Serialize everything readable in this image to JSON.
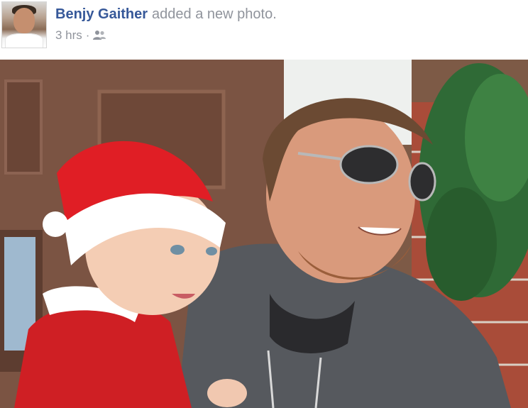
{
  "post": {
    "author": "Benjy Gaither",
    "action": "added a new photo.",
    "timestamp": "3 hrs",
    "separator": "·",
    "audience_icon": "friends-icon"
  },
  "photo": {
    "description_icon": "photo"
  },
  "colors": {
    "author_link": "#365899",
    "meta_text": "#90949c"
  }
}
